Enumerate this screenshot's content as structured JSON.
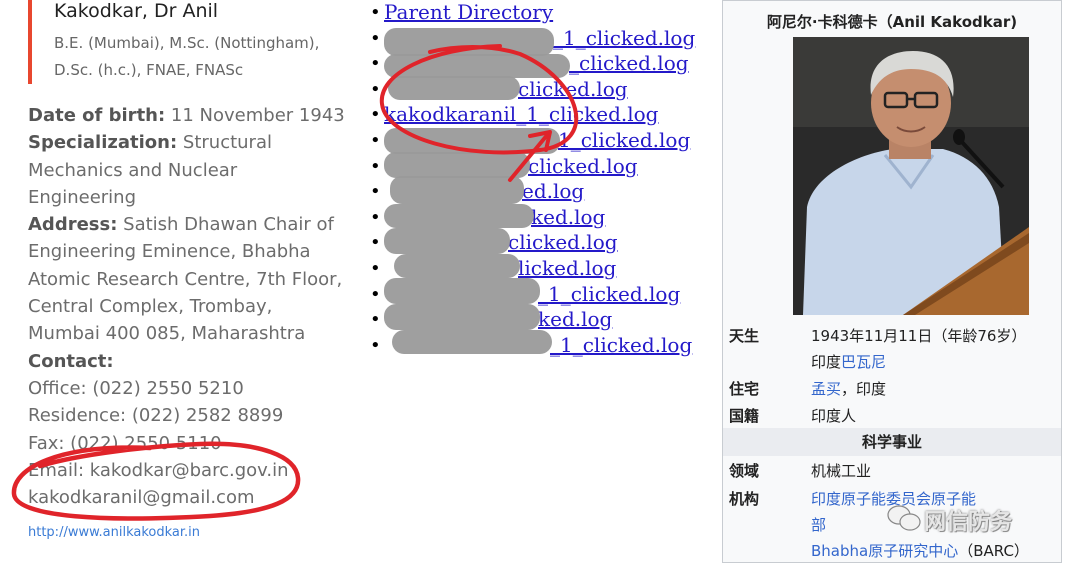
{
  "profile": {
    "name": "Kakodkar, Dr Anil",
    "degrees": "B.E. (Mumbai), M.Sc. (Nottingham), D.Sc. (h.c.), FNAE, FNASc",
    "dob_label": "Date of birth:",
    "dob_value": "11 November 1943",
    "spec_label": "Specialization:",
    "spec_line1": "Structural",
    "spec_line2": "Mechanics and Nuclear",
    "spec_line3": "Engineering",
    "address_label": "Address:",
    "address_line1": "Satish Dhawan Chair of",
    "address_line2": "Engineering Eminence, Bhabha",
    "address_line3": "Atomic Research Centre, 7th Floor,",
    "address_line4": "Central Complex, Trombay,",
    "address_line5": "Mumbai 400 085, Maharashtra",
    "contact_label": "Contact:",
    "office": "Office: (022) 2550 5210",
    "residence": "Residence: (022) 2582 8899",
    "fax": "Fax: (022) 2550 5110",
    "email": "Email: kakodkar@barc.gov.in",
    "email2": "kakodkaranil@gmail.com",
    "website": "http://www.anilkakodkar.in",
    "accent_color": "#e8472f",
    "annotation_color": "#e0242a"
  },
  "listing": {
    "parent": "Parent Directory",
    "files": [
      "_1_clicked.log",
      "_clicked.log",
      "clicked.log",
      "kakodkaranil_1_clicked.log",
      "1_clicked.log",
      "clicked.log",
      "ed.log",
      "ked.log",
      "clicked.log",
      "licked.log",
      "_1_clicked.log",
      "ked.log",
      "_1_clicked.log"
    ],
    "link_color": "#2419c9"
  },
  "infobox": {
    "title": "阿尼尔·卡科德卡（Anil Kakodkar)",
    "born_label": "天生",
    "born_value": "1943年11月11日（年龄76岁）",
    "born_place_prefix": "印度",
    "born_place_link": "巴瓦尼",
    "residence_label": "住宅",
    "residence_link": "孟买",
    "residence_suffix": "，印度",
    "nationality_label": "国籍",
    "nationality_value": "印度人",
    "section_title": "科学事业",
    "field_label": "领域",
    "field_value": "机械工业",
    "inst_label": "机构",
    "inst_line1": "印度原子能委员会原子能",
    "inst_line2": "部",
    "inst_line3_link": "Bhabha原子研究中心",
    "inst_line3_suffix": "（BARC）"
  },
  "watermark": {
    "text": "网信防务"
  }
}
